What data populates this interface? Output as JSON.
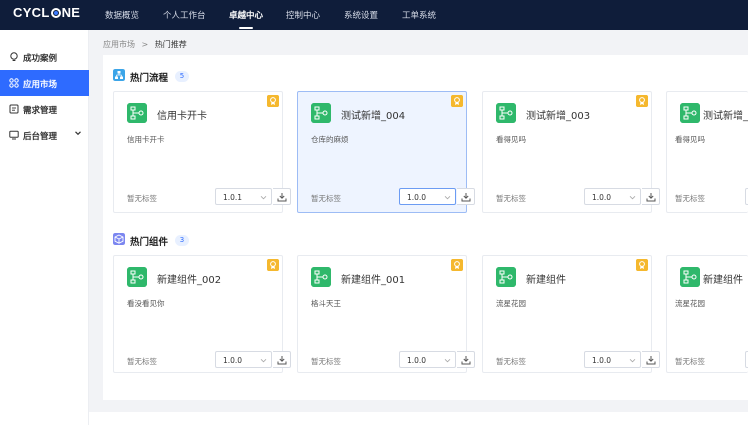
{
  "app": {
    "logo": "CYCLONE"
  },
  "nav": {
    "items": [
      {
        "label": "数据概览"
      },
      {
        "label": "个人工作台"
      },
      {
        "label": "卓越中心"
      },
      {
        "label": "控制中心"
      },
      {
        "label": "系统设置"
      },
      {
        "label": "工单系统"
      }
    ],
    "active_index": 2
  },
  "sidebar": {
    "items": [
      {
        "label": "成功案例",
        "icon": "lightbulb-icon"
      },
      {
        "label": "应用市场",
        "icon": "apps-grid-icon"
      },
      {
        "label": "需求管理",
        "icon": "clipboard-icon"
      },
      {
        "label": "后台管理",
        "icon": "monitor-icon"
      }
    ],
    "active_index": 1
  },
  "breadcrumb": {
    "root": "应用市场",
    "separator": ">",
    "current": "热门推荐"
  },
  "sections": [
    {
      "title": "热门流程",
      "count": "5",
      "cards": [
        {
          "title": "信用卡开卡",
          "desc": "信用卡开卡",
          "tag": "暂无标签",
          "version": "1.0.1"
        },
        {
          "title": "测试新增_004",
          "desc": "仓库的麻烦",
          "tag": "暂无标签",
          "version": "1.0.0"
        },
        {
          "title": "测试新增_003",
          "desc": "看得见吗",
          "tag": "暂无标签",
          "version": "1.0.0"
        },
        {
          "title": "测试新增_",
          "desc": "看得见吗",
          "tag": "暂无标签",
          "version": ""
        }
      ]
    },
    {
      "title": "热门组件",
      "count": "3",
      "cards": [
        {
          "title": "新建组件_002",
          "desc": "看没看见你",
          "tag": "暂无标签",
          "version": "1.0.0"
        },
        {
          "title": "新建组件_001",
          "desc": "格斗天王",
          "tag": "暂无标签",
          "version": "1.0.0"
        },
        {
          "title": "新建组件",
          "desc": "流星花园",
          "tag": "暂无标签",
          "version": "1.0.0"
        },
        {
          "title": "新建组件",
          "desc": "流星花园",
          "tag": "暂无标签",
          "version": ""
        }
      ]
    }
  ],
  "colors": {
    "nav_bg": "#0f1d3a",
    "accent": "#2e6bff",
    "card_icon": "#2fb86b",
    "badge": "#f5b82e"
  }
}
